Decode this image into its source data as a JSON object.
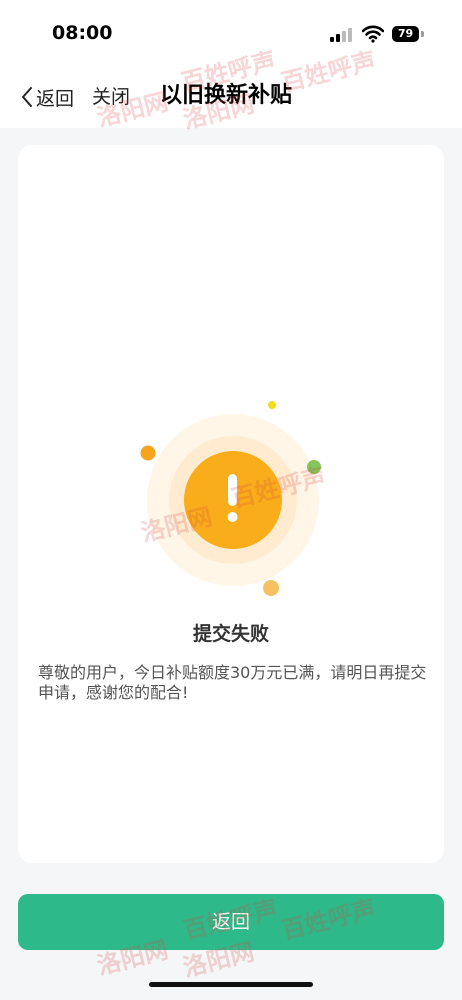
{
  "status_bar": {
    "time": "08:00",
    "battery": "79"
  },
  "nav": {
    "back_label": "返回",
    "close_label": "关闭",
    "title": "以旧换新补贴"
  },
  "result": {
    "icon": "exclamation-icon",
    "title": "提交失败",
    "message": "尊敬的用户，今日补贴额度30万元已满，请明日再提交申请，感谢您的配合!"
  },
  "footer": {
    "button_label": "返回"
  },
  "watermark": {
    "text_a": "洛阳网",
    "text_b": "百姓呼声"
  },
  "colors": {
    "accent": "#2eb98a",
    "warning_orange": "#f9ad1a",
    "page_bg": "#f5f6f8"
  }
}
